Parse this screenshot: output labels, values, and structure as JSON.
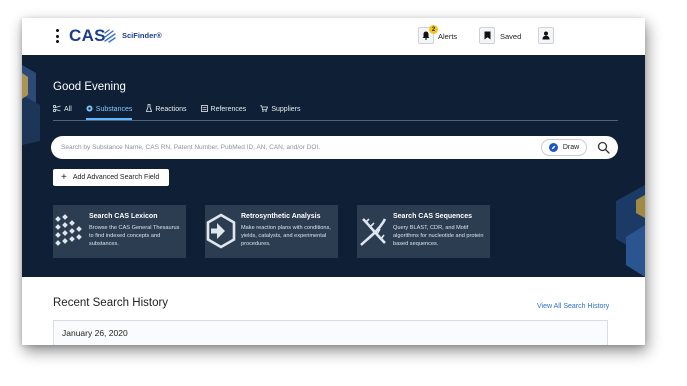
{
  "topbar": {
    "logo_text": "CAS",
    "product_name": "SciFinder",
    "product_mark": "®",
    "alerts_label": "Alerts",
    "alerts_count": "2",
    "saved_label": "Saved",
    "icons": [
      "kebab-menu-icon",
      "bell-icon",
      "bookmark-icon",
      "user-icon"
    ]
  },
  "hero": {
    "greeting": "Good Evening",
    "tabs": [
      {
        "label": "All",
        "icon": "all-icon",
        "active": false
      },
      {
        "label": "Substances",
        "icon": "substance-icon",
        "active": true
      },
      {
        "label": "Reactions",
        "icon": "flask-icon",
        "active": false
      },
      {
        "label": "References",
        "icon": "document-icon",
        "active": false
      },
      {
        "label": "Suppliers",
        "icon": "cart-icon",
        "active": false
      }
    ],
    "search": {
      "placeholder": "Search by Substance Name, CAS RN, Patent Number, PubMed ID, AN, CAN, and/or DOI.",
      "value": "",
      "draw_label": "Draw"
    },
    "advanced_button": "Add Advanced Search Field",
    "cards": [
      {
        "title": "Search CAS Lexicon",
        "desc": "Browse the CAS General Thesaurus to find indexed concepts and substances.",
        "icon": "lexicon-icon"
      },
      {
        "title": "Retrosynthetic Analysis",
        "desc": "Make reaction plans with conditions, yields, catalysts, and experimental procedures.",
        "icon": "retrosynthesis-icon"
      },
      {
        "title": "Search CAS Sequences",
        "desc": "Query BLAST, CDR, and Motif algorithms for nucleotide and protein based sequences.",
        "icon": "dna-icon"
      }
    ]
  },
  "history": {
    "title": "Recent Search History",
    "view_all": "View All Search History",
    "rows": [
      {
        "date": "January 26, 2020"
      }
    ]
  },
  "colors": {
    "hero_bg": "#0f2036",
    "card_bg": "#2c3d52",
    "brand_blue": "#1a3d8f",
    "active_tab": "#7fc8ff",
    "link": "#2a6fd6",
    "badge": "#f5c518"
  }
}
